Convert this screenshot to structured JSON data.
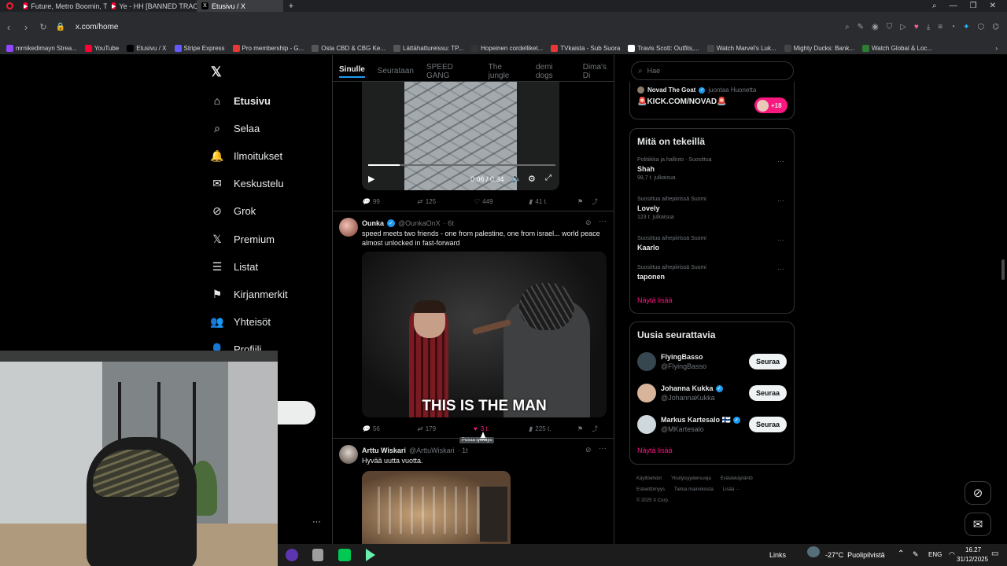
{
  "browser": {
    "tabs": [
      {
        "title": "Future, Metro Boomin, Tr",
        "color": "#ff0033",
        "active": false
      },
      {
        "title": "Ye - HH [BANNED TRACK]",
        "color": "#ff0033",
        "active": false
      },
      {
        "title": "Etusivu / X",
        "color": "#000000",
        "active": true
      }
    ],
    "new_tab_symbol": "+",
    "url": "x.com/home",
    "bookmarks": [
      {
        "label": "mrnikedimayn Strea...",
        "color": "#9146ff"
      },
      {
        "label": "YouTube",
        "color": "#ff0033"
      },
      {
        "label": "Etusivu / X",
        "color": "#000000"
      },
      {
        "label": "Stripe Express",
        "color": "#635bff"
      },
      {
        "label": "Pro membership - G...",
        "color": "#e53935"
      },
      {
        "label": "Osta CBD & CBG Ke...",
        "color": "#555555"
      },
      {
        "label": "Lättähattureissu: TP...",
        "color": "#555555"
      },
      {
        "label": "Hopeinen cordelliket...",
        "color": "#333333"
      },
      {
        "label": "TVkaista - Sub Suora",
        "color": "#e53935"
      },
      {
        "label": "Travis Scott: Outfits,...",
        "color": "#ffffff"
      },
      {
        "label": "Watch Marvel's Luk...",
        "color": "#444444"
      },
      {
        "label": "Mighty Ducks: Bank...",
        "color": "#444444"
      },
      {
        "label": "Watch Global & Loc...",
        "color": "#2e7d32"
      }
    ]
  },
  "sidebar": {
    "items": [
      {
        "label": "Etusivu",
        "icon": "home-icon",
        "glyph": "⌂",
        "active": true
      },
      {
        "label": "Selaa",
        "icon": "search-icon",
        "glyph": "⌕"
      },
      {
        "label": "Ilmoitukset",
        "icon": "bell-icon",
        "glyph": "🔔"
      },
      {
        "label": "Keskustelu",
        "icon": "mail-icon",
        "glyph": "✉"
      },
      {
        "label": "Grok",
        "icon": "grok-icon",
        "glyph": "⊘"
      },
      {
        "label": "Premium",
        "icon": "x-premium-icon",
        "glyph": "𝕏"
      },
      {
        "label": "Listat",
        "icon": "list-icon",
        "glyph": "☰"
      },
      {
        "label": "Kirjanmerkit",
        "icon": "bookmark-icon",
        "glyph": "⚑"
      },
      {
        "label": "Yhteisöt",
        "icon": "communities-icon",
        "glyph": "👥"
      },
      {
        "label": "Profiili",
        "icon": "profile-icon",
        "glyph": "👤"
      }
    ],
    "more": "···"
  },
  "feed": {
    "tabs": [
      "Sinulle",
      "Seurataan",
      "SPEED GANG",
      "The jungle",
      "demi dogs",
      "Dima's Di"
    ],
    "video": {
      "time": "0:06 / 0:34"
    },
    "tweet0_actions": {
      "replies": "99",
      "retweets": "125",
      "likes": "449",
      "views": "41 t."
    },
    "tweet1": {
      "name": "Ounka",
      "handle": "@OunkaOnX",
      "time": "· 6t",
      "text_line1": "speed meets two friends - one from palestine, one from israel... world peace",
      "text_line2": "almost unlocked in fast-forward",
      "caption": "THIS IS THE MAN",
      "replies": "56",
      "retweets": "179",
      "likes": "3 t.",
      "views": "225 t.",
      "tooltip": "Poista tykkäys"
    },
    "tweet2": {
      "name": "Arttu Wiskari",
      "handle": "@ArttuWiskari",
      "time": "· 1t",
      "text": "Hyvää uutta vuotta."
    }
  },
  "right": {
    "search_placeholder": "Hae",
    "live": {
      "name": "Novad The Goat",
      "status": "juontaa Huonetta",
      "title": "🚨KICK.COM/NOVAD🚨",
      "count": "+18"
    },
    "trends": {
      "title": "Mitä on tekeillä",
      "items": [
        {
          "category": "Politiikka ja hallinto · Suosittua",
          "name": "Shah",
          "count": "98,7 t. julkaisua"
        },
        {
          "category": "Suosittua aihepiirissä Suomi",
          "name": "Lovely",
          "count": "123 t. julkaisua"
        },
        {
          "category": "Suosittua aihepiirissä Suomi",
          "name": "Kaarlo",
          "count": ""
        },
        {
          "category": "Suosittua aihepiirissä Suomi",
          "name": "taponen",
          "count": ""
        }
      ],
      "more": "Näytä lisää"
    },
    "follow": {
      "title": "Uusia seurattavia",
      "button": "Seuraa",
      "users": [
        {
          "name": "FlyingBasso",
          "handle": "@FlyingBasso",
          "verified": false
        },
        {
          "name": "Johanna Kukka",
          "handle": "@JohannaKukka",
          "verified": true
        },
        {
          "name": "Markus Kartesalo 🇫🇮",
          "handle": "@MKartesalo",
          "verified": true
        }
      ],
      "more": "Näytä lisää"
    },
    "footer": {
      "row1": [
        "Käyttöehdot",
        "Yksityisyydensuoja",
        "Evästekäytäntö"
      ],
      "row2": [
        "Esteettömyys",
        "Tietoa mainoksista",
        "Lisää ···"
      ],
      "copyright": "© 2025 X Corp."
    }
  },
  "taskbar": {
    "links": "Links",
    "weather": "-27°C  Puolipilvistä",
    "lang": "ENG",
    "time": "16.27",
    "date": "31/12/2025"
  },
  "colors": {
    "accent": "#1d9bf0",
    "like": "#f91880",
    "background": "#000000"
  }
}
